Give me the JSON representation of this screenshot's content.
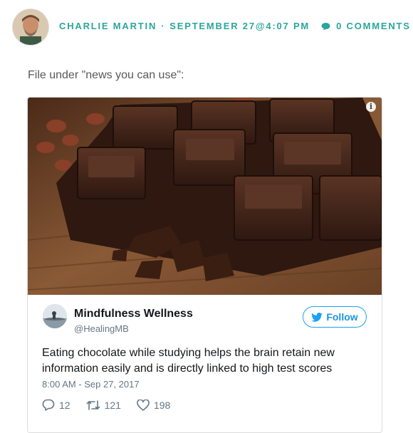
{
  "post": {
    "author": "CHARLIE MARTIN",
    "separator": "·",
    "date": "SEPTEMBER 27@4:07 PM",
    "comments": "0 COMMENTS",
    "intro": "File under \"news you can use\":"
  },
  "tweet": {
    "name": "Mindfulness Wellness",
    "handle": "@HealingMB",
    "follow_label": "Follow",
    "text": "Eating chocolate while studying helps the brain retain new information easily and is directly linked to high test scores",
    "date": "8:00 AM - Sep 27, 2017",
    "replies": "12",
    "retweets": "121",
    "likes": "198",
    "info_icon": "i"
  },
  "colors": {
    "accent": "#2aa69a",
    "twitter_blue": "#1da1f2",
    "text_muted": "#657786"
  },
  "icons": [
    "comment-bubble-icon",
    "info-icon",
    "twitter-bird-icon",
    "reply-icon",
    "retweet-icon",
    "like-heart-icon"
  ]
}
